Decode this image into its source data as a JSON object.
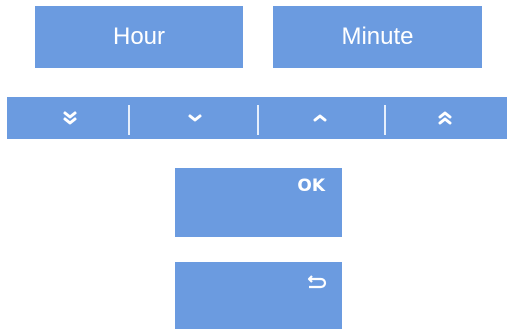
{
  "time_picker": {
    "hour_label": "Hour",
    "minute_label": "Minute"
  },
  "stepper": {
    "buttons": [
      {
        "icon": "double-chevron-down-icon"
      },
      {
        "icon": "chevron-down-icon"
      },
      {
        "icon": "chevron-up-icon"
      },
      {
        "icon": "double-chevron-up-icon"
      }
    ]
  },
  "actions": {
    "ok_label": "OK",
    "back_icon": "return-arrow-icon"
  },
  "colors": {
    "button_fill": "#6b9be0",
    "text": "#ffffff"
  }
}
